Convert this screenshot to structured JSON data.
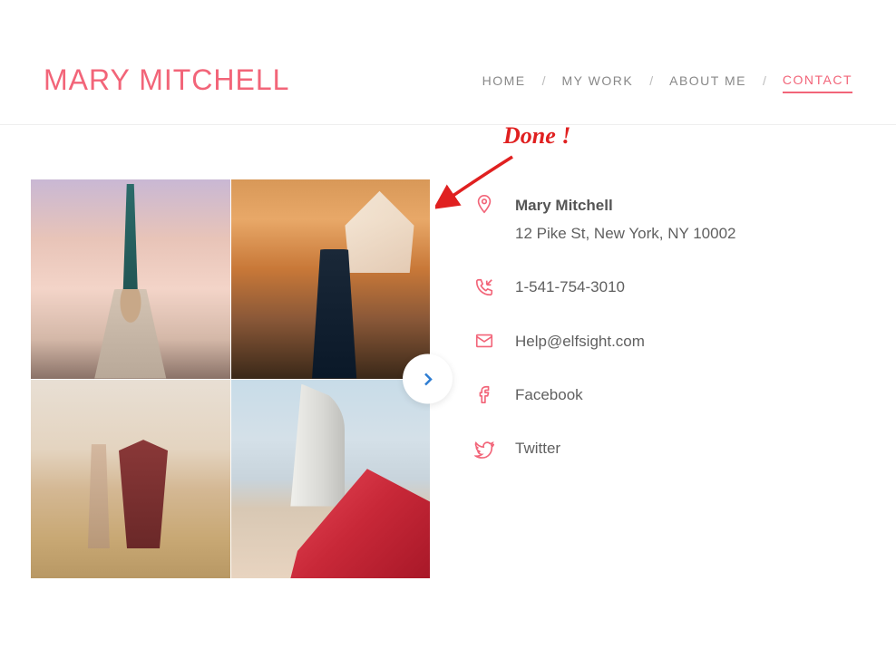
{
  "header": {
    "logo": "MARY MITCHELL",
    "nav": {
      "home": "HOME",
      "work": "MY WORK",
      "about": "ABOUT ME",
      "contact": "CONTACT",
      "separator": "/"
    }
  },
  "annotation": {
    "text": "Done !"
  },
  "contact": {
    "name": "Mary Mitchell",
    "address": "12 Pike St, New York, NY 10002",
    "phone": "1-541-754-3010",
    "email": "Help@elfsight.com",
    "facebook": "Facebook",
    "twitter": "Twitter"
  }
}
